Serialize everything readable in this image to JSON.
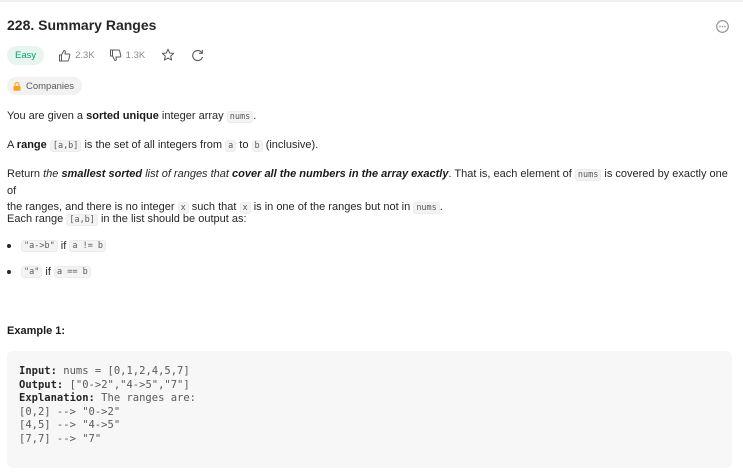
{
  "problem": {
    "title": "228. Summary Ranges",
    "difficulty": "Easy",
    "likes": "2.3K",
    "dislikes": "1.3K",
    "companies_label": "Companies"
  },
  "description": {
    "p1": {
      "pre": "You are given a ",
      "bold": "sorted unique",
      "mid": " integer array ",
      "code": "nums",
      "post": "."
    },
    "p2": {
      "pre": "A ",
      "bold": "range",
      "code1": "[a,b]",
      "mid1": " is the set of all integers from ",
      "code2": "a",
      "mid2": " to ",
      "code3": "b",
      "post": " (inclusive)."
    },
    "p3": {
      "pre": "Return ",
      "it1": "the ",
      "bold_it1": "smallest sorted",
      "it2": " list of ranges that ",
      "bold_it2": "cover all the numbers in the array exactly",
      "mid": ". That is, each element of ",
      "code1": "nums",
      "mid2": " is covered by exactly one of",
      "line2_pre": "the ranges, and there is no integer ",
      "code2": "x",
      "line2_mid": " such that ",
      "code3": "x",
      "line2_mid2": " is in one of the ranges but not in ",
      "code4": "nums",
      "line2_post": "."
    },
    "p4": {
      "pre": "Each range ",
      "code": "[a,b]",
      "post": " in the list should be output as:"
    },
    "bullets": [
      {
        "code1": "\"a->b\"",
        "mid": " if ",
        "code2": "a != b"
      },
      {
        "code1": "\"a\"",
        "mid": " if ",
        "code2": "a == b"
      }
    ]
  },
  "example1": {
    "title": "Example 1:",
    "input_label": "Input:",
    "input_value": " nums = [0,1,2,4,5,7]",
    "output_label": "Output:",
    "output_value": " [\"0->2\",\"4->5\",\"7\"]",
    "explanation_label": "Explanation:",
    "explanation_value": " The ranges are:",
    "lines": [
      "[0,2] --> \"0->2\"",
      "[4,5] --> \"4->5\"",
      "[7,7] --> \"7\""
    ]
  },
  "colors": {
    "easy": "#00a371",
    "easy_bg": "#e8f5ef",
    "lock": "#ffa116"
  }
}
